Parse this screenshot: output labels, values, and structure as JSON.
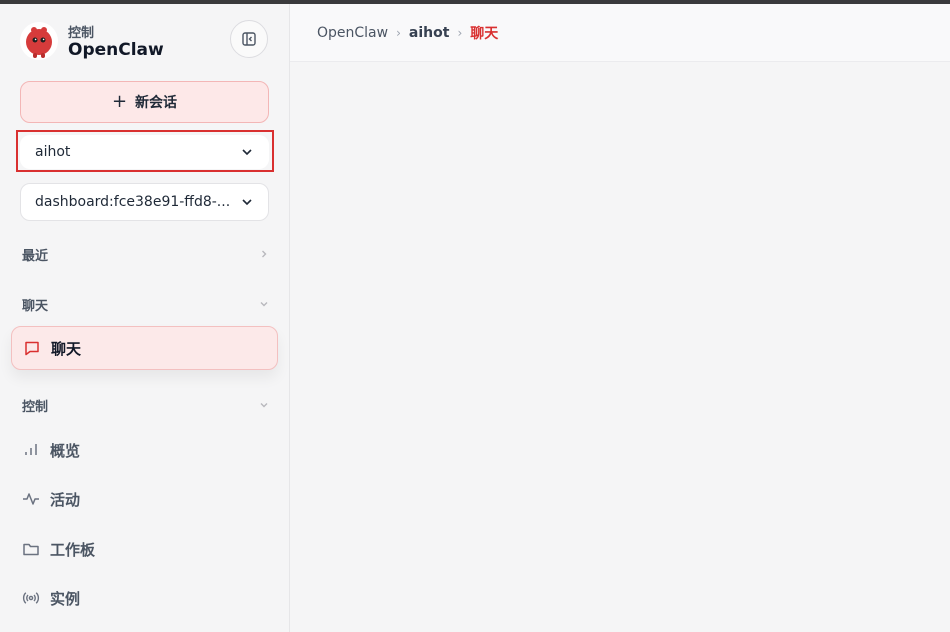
{
  "brand": {
    "subtitle": "控制",
    "title": "OpenClaw"
  },
  "sidebar": {
    "new_chat_label": "新会话",
    "agent_select_value": "aihot",
    "session_select_value": "dashboard:fce38e91-ffd8-...",
    "sections": {
      "recent": "最近",
      "chat": "聊天",
      "control": "控制"
    },
    "items": [
      {
        "label": "聊天",
        "icon": "message-square-icon",
        "active": true
      },
      {
        "label": "概览",
        "icon": "bar-chart-icon",
        "active": false
      },
      {
        "label": "活动",
        "icon": "activity-icon",
        "active": false
      },
      {
        "label": "工作板",
        "icon": "folder-icon",
        "active": false
      },
      {
        "label": "实例",
        "icon": "radio-icon",
        "active": false
      }
    ]
  },
  "breadcrumb": {
    "root": "OpenClaw",
    "middle": "aihot",
    "current": "聊天"
  },
  "colors": {
    "accent": "#d93030",
    "active_bg": "#fce9e9"
  }
}
